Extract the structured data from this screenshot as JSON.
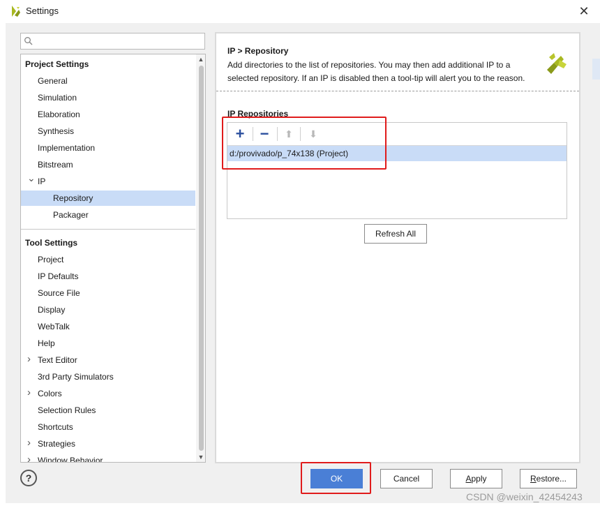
{
  "window": {
    "title": "Settings",
    "close_glyph": "✕"
  },
  "search": {
    "placeholder": "",
    "value": ""
  },
  "tree": {
    "project_header": "Project Settings",
    "project_items": [
      "General",
      "Simulation",
      "Elaboration",
      "Synthesis",
      "Implementation",
      "Bitstream"
    ],
    "ip_label": "IP",
    "ip_children": [
      "Repository",
      "Packager"
    ],
    "selected": "Repository",
    "tool_header": "Tool Settings",
    "tool_items": [
      "Project",
      "IP Defaults",
      "Source File",
      "Display",
      "WebTalk",
      "Help",
      "Text Editor",
      "3rd Party Simulators",
      "Colors",
      "Selection Rules",
      "Shortcuts",
      "Strategies",
      "Window Behavior"
    ],
    "expandable": [
      "Text Editor",
      "Colors",
      "Strategies",
      "Window Behavior"
    ]
  },
  "panel": {
    "breadcrumb": "IP > Repository",
    "description": "Add directories to the list of repositories. You may then add additional IP to a selected repository. If an IP is disabled then a tool-tip will alert you to the reason.",
    "section_title": "IP Repositories",
    "toolbar": {
      "add_glyph": "+",
      "remove_glyph": "−",
      "up_glyph": "⬆",
      "down_glyph": "⬇"
    },
    "repositories": [
      "d:/provivado/p_74x138 (Project)"
    ],
    "refresh_label": "Refresh All"
  },
  "buttons": {
    "ok": "OK",
    "cancel": "Cancel",
    "apply": "Apply",
    "restore": "Restore...",
    "help": "?"
  },
  "watermark": "CSDN @weixin_42454243",
  "colors": {
    "selection": "#c9dcf7",
    "ok_button": "#4a7fd6",
    "highlight_box": "#e01b1b",
    "logo": "#a8b821"
  }
}
